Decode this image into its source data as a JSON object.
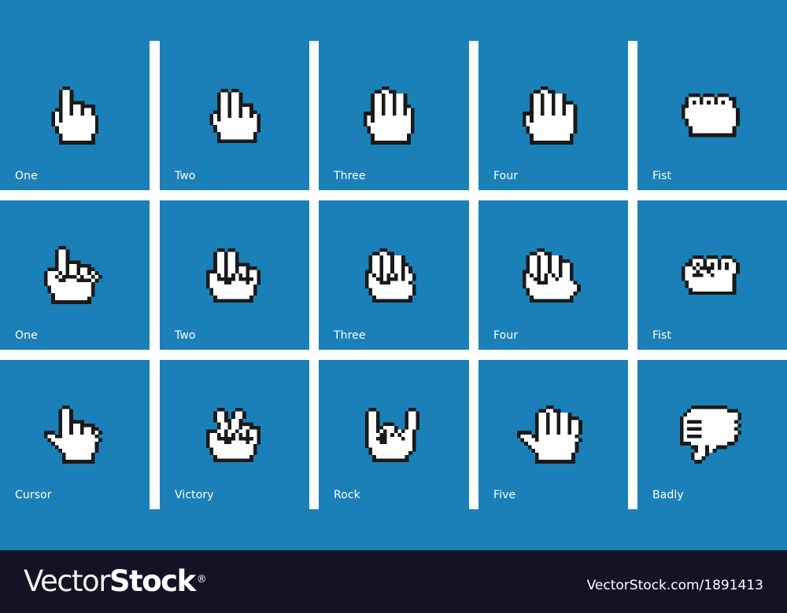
{
  "colors": {
    "tile_background": "#1b80b8",
    "divider": "#ffffff",
    "footer_background": "#131325",
    "hand_fill": "#ffffff",
    "hand_outline": "#1a1a1a"
  },
  "grid": {
    "rows": [
      {
        "tiles": [
          {
            "label": "One",
            "icon": "hand-pointing-one-icon"
          },
          {
            "label": "Two",
            "icon": "hand-two-fingers-icon"
          },
          {
            "label": "Three",
            "icon": "hand-three-fingers-icon"
          },
          {
            "label": "Four",
            "icon": "hand-four-fingers-icon"
          },
          {
            "label": "Fist",
            "icon": "hand-fist-icon"
          }
        ]
      },
      {
        "tiles": [
          {
            "label": "One",
            "icon": "hand-back-one-icon"
          },
          {
            "label": "Two",
            "icon": "hand-back-two-icon"
          },
          {
            "label": "Three",
            "icon": "hand-back-three-icon"
          },
          {
            "label": "Four",
            "icon": "hand-back-four-icon"
          },
          {
            "label": "Fist",
            "icon": "hand-back-fist-icon"
          }
        ]
      },
      {
        "tiles": [
          {
            "label": "Cursor",
            "icon": "hand-cursor-icon"
          },
          {
            "label": "Victory",
            "icon": "hand-victory-icon"
          },
          {
            "label": "Rock",
            "icon": "hand-rock-icon"
          },
          {
            "label": "Five",
            "icon": "hand-five-icon"
          },
          {
            "label": "Badly",
            "icon": "hand-thumbs-down-icon"
          }
        ]
      }
    ]
  },
  "footer": {
    "logo_light": "Vector",
    "logo_bold": "Stock",
    "logo_mark": "®",
    "image_id": "VectorStock.com/1891413"
  }
}
